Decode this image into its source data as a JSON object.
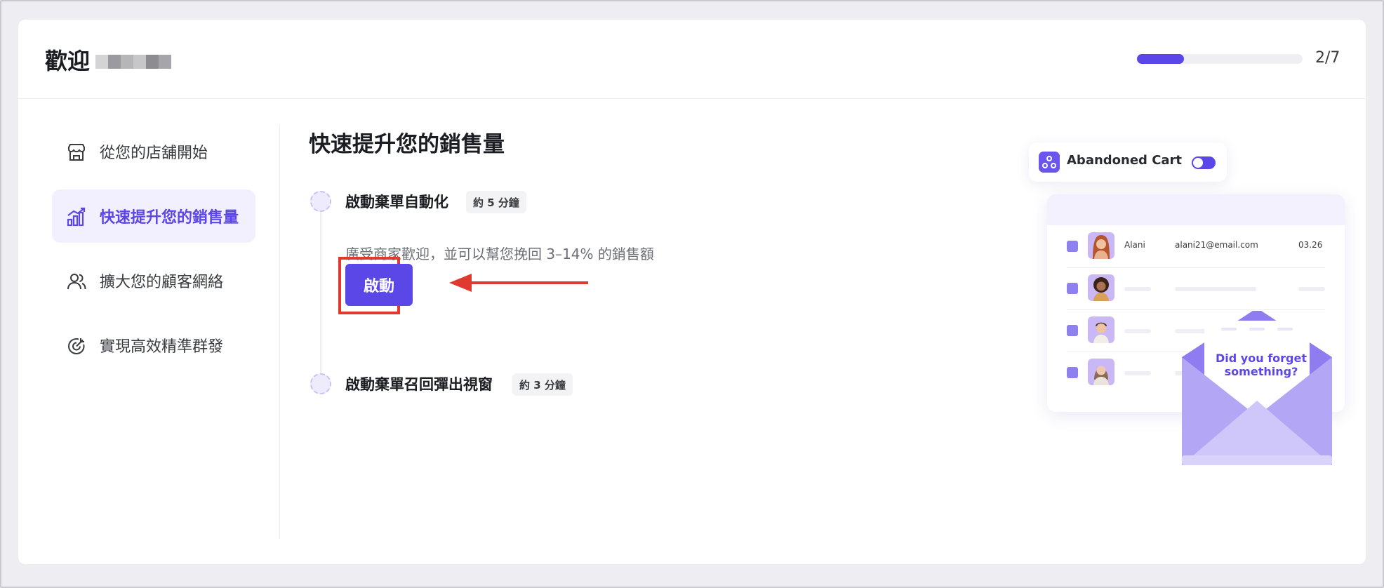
{
  "header": {
    "welcome": "歡迎",
    "progress": {
      "current": 2,
      "total": 7,
      "fraction": 0.2857
    },
    "step_counter": "2/7"
  },
  "sidebar": {
    "items": [
      {
        "label": "從您的店舖開始",
        "icon": "store-icon",
        "active": false
      },
      {
        "label": "快速提升您的銷售量",
        "icon": "bar-chart-icon",
        "active": true
      },
      {
        "label": "擴大您的顧客網絡",
        "icon": "users-icon",
        "active": false
      },
      {
        "label": "實現高效精準群發",
        "icon": "target-icon",
        "active": false
      }
    ]
  },
  "main": {
    "title": "快速提升您的銷售量",
    "steps": [
      {
        "title": "啟動棄單自動化",
        "time": "約 5 分鐘",
        "description": "廣受商家歡迎，並可以幫您挽回 3–14% 的銷售額",
        "button_label": "啟動"
      },
      {
        "title": "啟動棄單召回彈出視窗",
        "time": "約 3 分鐘"
      }
    ]
  },
  "illustration": {
    "cart_title": "Abandoned Cart",
    "row1": {
      "name": "Alani",
      "email": "alani21@email.com",
      "date": "03.26"
    },
    "envelope_text": "Did you  forget something?"
  },
  "colors": {
    "accent": "#5b46e8",
    "accent_soft": "#f2f0fe",
    "highlight": "#e03a2e"
  }
}
